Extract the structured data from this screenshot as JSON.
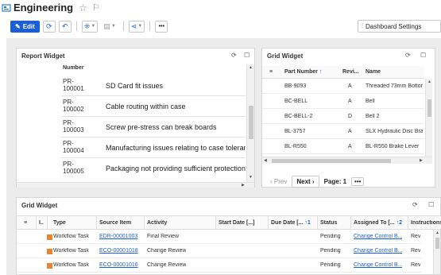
{
  "header": {
    "title": "Engineering"
  },
  "toolbar": {
    "edit_label": "Edit",
    "more_label": "•••",
    "dashboard_settings_label": "Dashboard Settings"
  },
  "report_widget": {
    "title": "Report Widget",
    "column_header": "Number",
    "rows": [
      {
        "id_line1": "PR-",
        "id_line2": "100001",
        "description": "SD Card fit issues"
      },
      {
        "id_line1": "PR-",
        "id_line2": "100002",
        "description": "Cable routing within case"
      },
      {
        "id_line1": "PR-",
        "id_line2": "100003",
        "description": "Screw pre-stress can break boards"
      },
      {
        "id_line1": "PR-",
        "id_line2": "100004",
        "description": "Manufacturing issues relating to case tolerances"
      },
      {
        "id_line1": "PR-",
        "id_line2": "100005",
        "description": "Packaging not providing sufficient protection"
      }
    ]
  },
  "grid_widget_top": {
    "title": "Grid Widget",
    "columns": [
      "Part Number",
      "Revi...",
      "Name"
    ],
    "rows": [
      {
        "part": "BB-9093",
        "rev": "A",
        "name": "Threaded 73mm Bottom"
      },
      {
        "part": "BC-BELL",
        "rev": "A",
        "name": "Bell"
      },
      {
        "part": "BC-BELL-2",
        "rev": "D",
        "name": "Bell 2"
      },
      {
        "part": "BL-3757",
        "rev": "A",
        "name": "SLX Hydraulic Disc Brake"
      },
      {
        "part": "BL-R550",
        "rev": "A",
        "name": "BL-R550 Brake Lever"
      }
    ],
    "pager": {
      "prev": "Prev",
      "next": "Next",
      "page": "Page: 1",
      "more": "•••"
    }
  },
  "grid_widget_bottom": {
    "title": "Grid Widget",
    "columns": {
      "i": "I..",
      "type": "Type",
      "source": "Source Item",
      "activity": "Activity",
      "start": "Start Date [...]",
      "due": "Due Date [...",
      "due_sort": "1",
      "status": "Status",
      "assigned": "Assigned To [...",
      "assigned_sort": "2",
      "instr": "Instructions"
    },
    "rows": [
      {
        "type": "Workflow Task",
        "source": "EDR-00001003",
        "activity": "Final Review",
        "status": "Pending",
        "assigned": "Change Control B...",
        "instr": "Rev"
      },
      {
        "type": "Workflow Task",
        "source": "ECO-00001018",
        "activity": "Change Review",
        "status": "Pending",
        "assigned": "Change Control B...",
        "instr": "Rev"
      },
      {
        "type": "Workflow Task",
        "source": "ECO-00001016",
        "activity": "Change Review",
        "status": "Pending",
        "assigned": "Change Control B...",
        "instr": "Rev"
      }
    ]
  },
  "colors": {
    "accent": "#1a5fd8",
    "task_icon": "#e9832f"
  }
}
